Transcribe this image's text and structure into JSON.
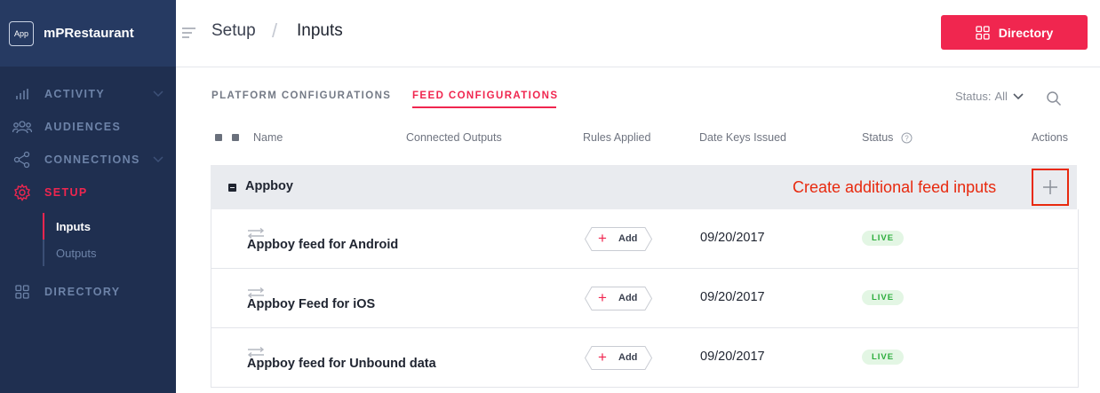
{
  "app": {
    "badge": "App",
    "name": "mPRestaurant"
  },
  "sidebar": {
    "items": [
      {
        "label": "ACTIVITY",
        "icon": "bar-chart-icon",
        "expandable": true
      },
      {
        "label": "AUDIENCES",
        "icon": "people-icon",
        "expandable": false
      },
      {
        "label": "CONNECTIONS",
        "icon": "connections-icon",
        "expandable": true
      },
      {
        "label": "SETUP",
        "icon": "gear-icon",
        "expandable": false,
        "active": true
      },
      {
        "label": "DIRECTORY",
        "icon": "grid-icon",
        "expandable": false
      }
    ],
    "setup_subitems": [
      {
        "label": "Inputs",
        "active": true
      },
      {
        "label": "Outputs",
        "active": false
      }
    ]
  },
  "header": {
    "breadcrumb": [
      "Setup",
      "Inputs"
    ],
    "separator": "/",
    "directory_button": "Directory"
  },
  "tabs": [
    {
      "label": "PLATFORM CONFIGURATIONS",
      "active": false
    },
    {
      "label": "FEED CONFIGURATIONS",
      "active": true
    }
  ],
  "filter": {
    "status_label": "Status:",
    "status_value": "All"
  },
  "table": {
    "columns": [
      "Name",
      "Connected Outputs",
      "Rules Applied",
      "Date Keys Issued",
      "Status",
      "Actions"
    ],
    "group": {
      "name": "Appboy"
    },
    "rows": [
      {
        "name": "Appboy feed for Android",
        "rules_button": "Add",
        "date": "09/20/2017",
        "status": "LIVE"
      },
      {
        "name": "Appboy Feed for iOS",
        "rules_button": "Add",
        "date": "09/20/2017",
        "status": "LIVE"
      },
      {
        "name": "Appboy feed for Unbound data",
        "rules_button": "Add",
        "date": "09/20/2017",
        "status": "LIVE"
      }
    ]
  },
  "annotation": {
    "text": "Create additional feed inputs",
    "color": "#e8290e"
  },
  "colors": {
    "accent": "#f0264f",
    "sidebar": "#1f2f50",
    "live": "#2cad3c"
  }
}
